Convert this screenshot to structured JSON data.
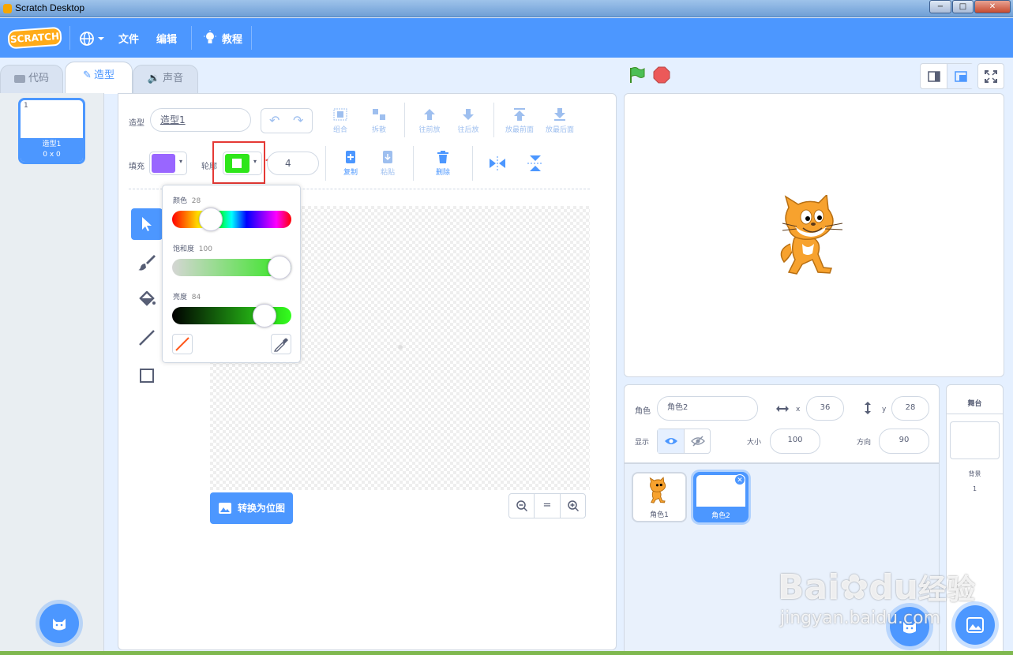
{
  "window": {
    "title": "Scratch Desktop",
    "buttons": [
      "−",
      "□",
      "✕"
    ]
  },
  "menu": {
    "logo": "SCRATCH",
    "file": "文件",
    "edit": "编辑",
    "tutorials": "教程"
  },
  "tabs": [
    {
      "label": "代码"
    },
    {
      "label": "造型"
    },
    {
      "label": "声音"
    }
  ],
  "costumes": [
    {
      "index": "1",
      "name": "造型1",
      "size": "0 x 0"
    }
  ],
  "editor": {
    "costume_label": "造型",
    "costume_name": "造型1",
    "fill_label": "填充",
    "outline_label": "轮廓",
    "outline_width": "4",
    "fill_color": "#9966ff",
    "outline_color": "#2ee61a",
    "toolbar": {
      "group": "组合",
      "ungroup": "拆散",
      "forward": "往前放",
      "backward": "往后放",
      "front": "放最前面",
      "back": "放最后面",
      "copy": "复制",
      "paste": "粘贴",
      "delete": "删除"
    },
    "convert_button": "转换为位图",
    "zoom": {
      "out": "−",
      "reset": "=",
      "in": "+"
    }
  },
  "color_picker": {
    "hue_label": "颜色",
    "hue_value": "28",
    "hue_level": 0.28,
    "saturation_label": "饱和度",
    "saturation_value": "100",
    "saturation_level": 1.0,
    "brightness_label": "亮度",
    "brightness_value": "84",
    "brightness_level": 0.84
  },
  "sprite_info": {
    "sprite_label": "角色",
    "sprite_name": "角色2",
    "x_label": "x",
    "x": "36",
    "y_label": "y",
    "y": "28",
    "show_label": "显示",
    "size_label": "大小",
    "size": "100",
    "direction_label": "方向",
    "direction": "90"
  },
  "sprites": [
    {
      "name": "角色1"
    },
    {
      "name": "角色2"
    }
  ],
  "stage_panel": {
    "title": "舞台",
    "backdrops_label": "背景",
    "backdrops_count": "1"
  },
  "watermark": {
    "brand": "Bai",
    "brand2": "du",
    "brand_cn": "经验",
    "url": "jingyan.baidu.com"
  }
}
